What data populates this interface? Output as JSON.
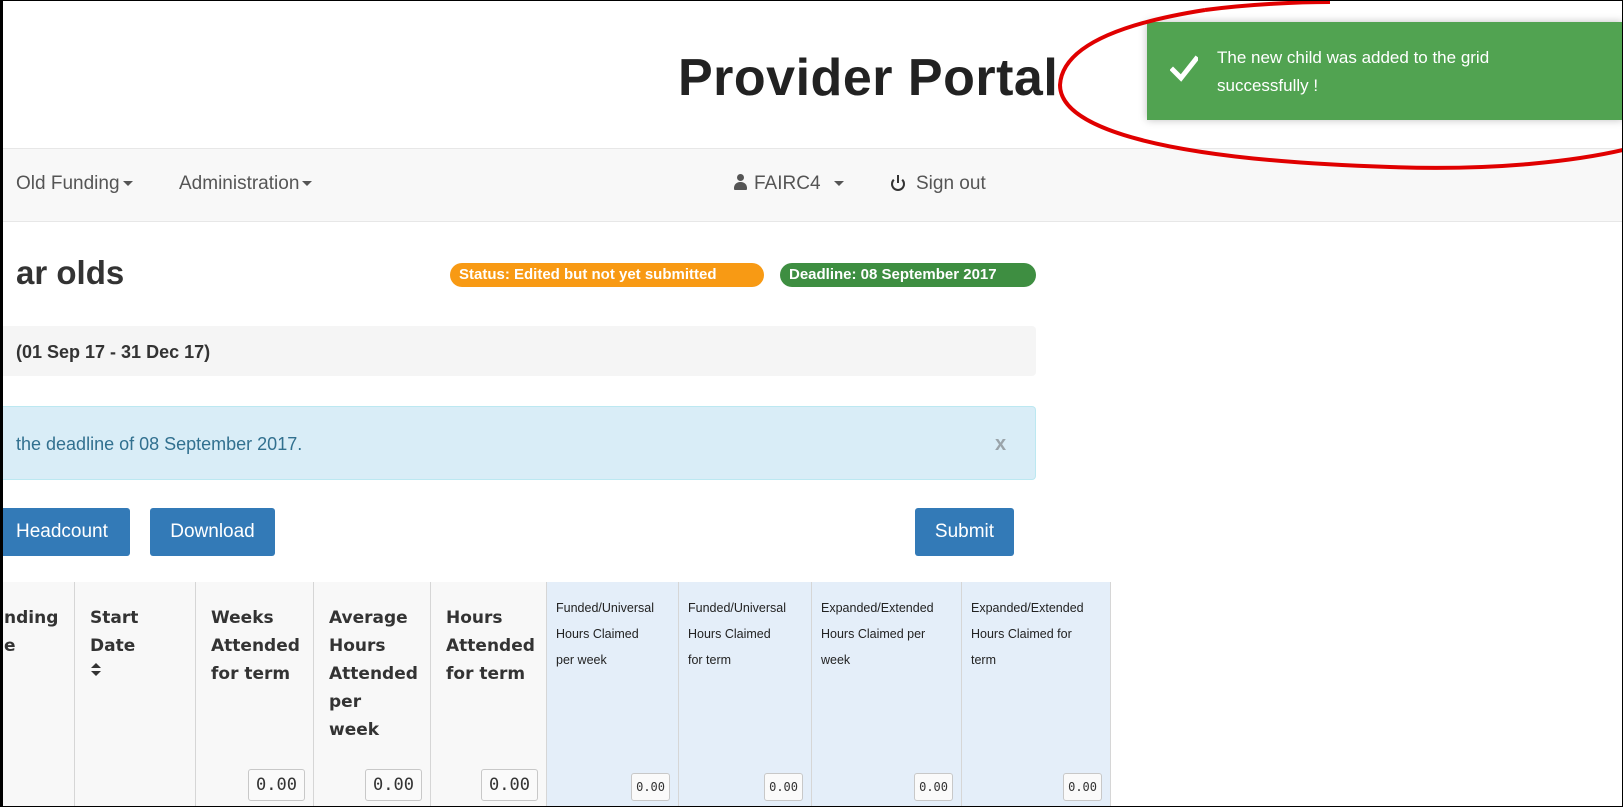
{
  "header": {
    "title": "Provider Portal"
  },
  "nav": {
    "old_funding": "Old Funding",
    "administration": "Administration",
    "user": "FAIRC4",
    "sign_out": "Sign out"
  },
  "page": {
    "heading": "ar olds",
    "status_badge": "Status: Edited but not yet submitted",
    "deadline_badge": "Deadline: 08 September 2017",
    "term": "(01 Sep 17 - 31 Dec 17)",
    "info_message": "the deadline of 08 September 2017.",
    "info_close": "x"
  },
  "buttons": {
    "headcount": "Headcount",
    "download": "Download",
    "submit": "Submit"
  },
  "table": {
    "columns": [
      {
        "label": "nding\ne",
        "total": ""
      },
      {
        "label": "Start\nDate",
        "total": ""
      },
      {
        "label": "Weeks\nAttended\nfor term",
        "total": "0.00"
      },
      {
        "label": "Average\nHours\nAttended\nper\nweek",
        "total": "0.00"
      },
      {
        "label": "Hours\nAttended\nfor term",
        "total": "0.00"
      },
      {
        "label": "Funded/Universal\nHours Claimed\nper week",
        "total": "0.00"
      },
      {
        "label": "Funded/Universal\nHours Claimed\nfor term",
        "total": "0.00"
      },
      {
        "label": "Expanded/Extended\nHours Claimed per\nweek",
        "total": "0.00"
      },
      {
        "label": "Expanded/Extended\nHours Claimed for\nterm",
        "total": "0.00"
      }
    ]
  },
  "toast": {
    "message": "The new child was added to the grid successfully !"
  },
  "colors": {
    "toast_bg": "#51a351",
    "status_badge": "#f89a14",
    "deadline_badge": "#3e8e41",
    "primary_button": "#337ab7",
    "annotation_circle": "#e00000"
  }
}
